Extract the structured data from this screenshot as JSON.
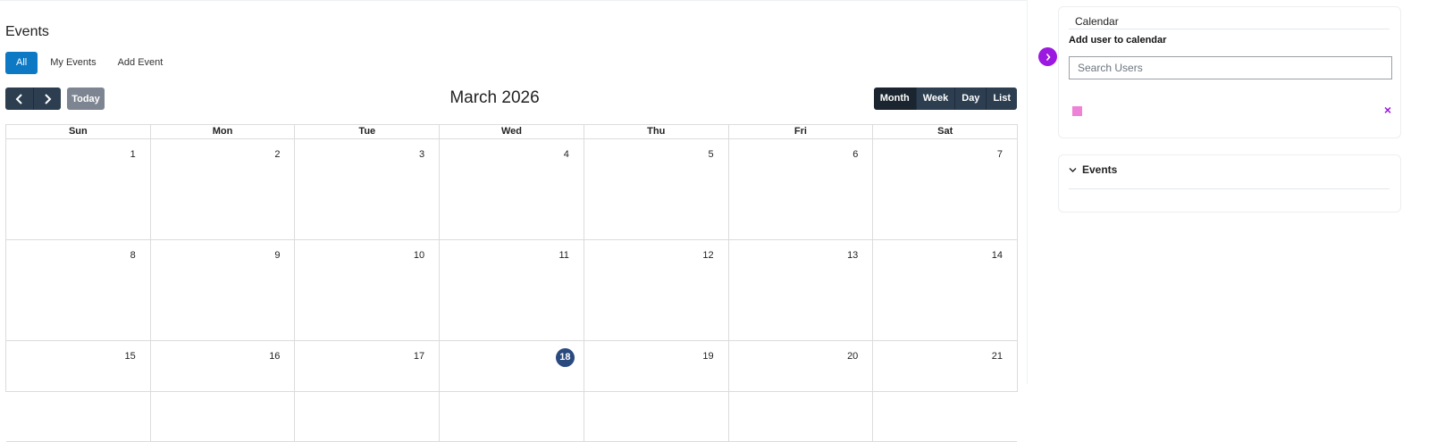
{
  "page": {
    "title": "Events"
  },
  "tabs": [
    {
      "label": "All",
      "active": true
    },
    {
      "label": "My Events",
      "active": false
    },
    {
      "label": "Add Event",
      "active": false
    }
  ],
  "toolbar": {
    "prev_icon": "chevron-left-icon",
    "next_icon": "chevron-right-icon",
    "today_label": "Today",
    "title": "March 2026",
    "views": [
      {
        "label": "Month",
        "active": true
      },
      {
        "label": "Week",
        "active": false
      },
      {
        "label": "Day",
        "active": false
      },
      {
        "label": "List",
        "active": false
      }
    ]
  },
  "calendar": {
    "weekdays": [
      "Sun",
      "Mon",
      "Tue",
      "Wed",
      "Thu",
      "Fri",
      "Sat"
    ],
    "weeks": [
      [
        "1",
        "2",
        "3",
        "4",
        "5",
        "6",
        "7"
      ],
      [
        "8",
        "9",
        "10",
        "11",
        "12",
        "13",
        "14"
      ],
      [
        "15",
        "16",
        "17",
        "18",
        "19",
        "20",
        "21"
      ]
    ],
    "today": "18",
    "today_color": "#2a4a7f"
  },
  "side_panel": {
    "toggle_icon": "chevron-right-icon",
    "toggle_color": "#9b19e0",
    "calendar_card": {
      "title": "Calendar",
      "add_label": "Add user to calendar",
      "search_placeholder": "Search Users",
      "user_swatch_color": "#ee82d6",
      "remove_label": "×",
      "remove_color": "#9b19e0"
    },
    "events_card": {
      "title": "Events",
      "chevron_icon": "chevron-down-icon"
    }
  },
  "colors": {
    "primary_tab": "#0d79c4",
    "toolbar_button": "#2c3e50",
    "today_button": "#7c8591"
  }
}
